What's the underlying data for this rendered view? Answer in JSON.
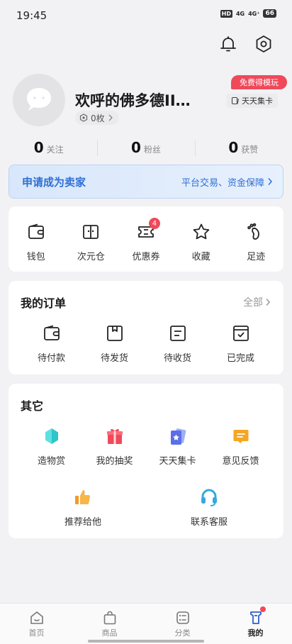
{
  "status_bar": {
    "time": "19:45",
    "hd": "HD",
    "net1": "4G",
    "net2": "4G⁺",
    "battery": "66"
  },
  "header": {
    "bell_icon": "bell-icon",
    "settings_icon": "settings-icon"
  },
  "profile": {
    "username": "欢呼的佛多德II…",
    "coins": "0枚",
    "free_badge": "免费得模玩",
    "card_button": "天天集卡"
  },
  "stats": [
    {
      "count": "0",
      "label": "关注"
    },
    {
      "count": "0",
      "label": "粉丝"
    },
    {
      "count": "0",
      "label": "获赞"
    }
  ],
  "seller_banner": {
    "title": "申请成为卖家",
    "subtitle": "平台交易、资金保障"
  },
  "quick_tools": [
    {
      "label": "钱包",
      "icon": "wallet-icon"
    },
    {
      "label": "次元仓",
      "icon": "storage-icon"
    },
    {
      "label": "优惠券",
      "icon": "coupon-icon",
      "badge": "4"
    },
    {
      "label": "收藏",
      "icon": "star-icon"
    },
    {
      "label": "足迹",
      "icon": "footprint-icon"
    }
  ],
  "orders": {
    "title": "我的订单",
    "all_label": "全部",
    "items": [
      {
        "label": "待付款",
        "icon": "wallet-icon"
      },
      {
        "label": "待发货",
        "icon": "package-icon"
      },
      {
        "label": "待收货",
        "icon": "receipt-icon"
      },
      {
        "label": "已完成",
        "icon": "completed-icon"
      }
    ]
  },
  "others": {
    "title": "其它",
    "items": [
      {
        "label": "造物赏",
        "icon": "gem-icon"
      },
      {
        "label": "我的抽奖",
        "icon": "gift-icon"
      },
      {
        "label": "天天集卡",
        "icon": "card-star-icon"
      },
      {
        "label": "意见反馈",
        "icon": "feedback-icon"
      },
      {
        "label": "推荐给他",
        "icon": "thumbs-up-icon"
      },
      {
        "label": "联系客服",
        "icon": "headset-icon"
      }
    ]
  },
  "tabbar": [
    {
      "label": "首页",
      "icon": "home-icon"
    },
    {
      "label": "商品",
      "icon": "bag-icon"
    },
    {
      "label": "分类",
      "icon": "category-icon"
    },
    {
      "label": "我的",
      "icon": "profile-icon",
      "active": true
    }
  ],
  "colors": {
    "accent": "#2f6fd4",
    "badge": "#f0495a",
    "background": "#f2f2f4"
  }
}
